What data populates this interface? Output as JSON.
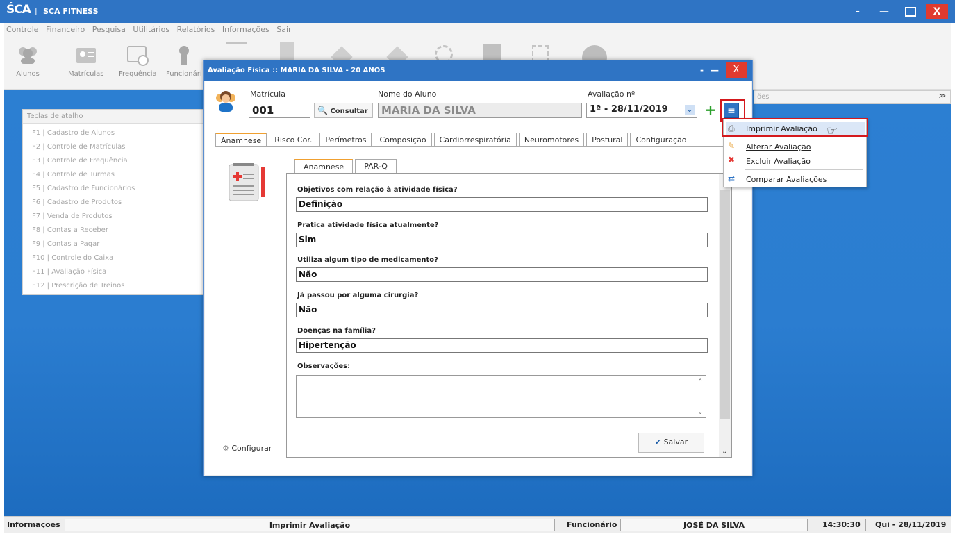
{
  "app": {
    "logo": "ŚCA",
    "title": "SCA FITNESS",
    "window_buttons": {
      "minimize": "-",
      "restore": "—",
      "close": "X"
    }
  },
  "menu": [
    "Controle",
    "Financeiro",
    "Pesquisa",
    "Utilitários",
    "Relatórios",
    "Informações",
    "Sair"
  ],
  "toolbar": {
    "items": [
      {
        "label": "Alunos",
        "icon": "students-icon"
      },
      {
        "label": "Matrículas",
        "icon": "enrollment-icon"
      },
      {
        "label": "Frequência",
        "icon": "calendar-clock-icon"
      },
      {
        "label": "Funcionári",
        "icon": "employee-icon"
      }
    ]
  },
  "shortcuts": {
    "header": "Teclas de atalho",
    "items": [
      "F1 | Cadastro de Alunos",
      "F2 | Controle de Matrículas",
      "F3 | Controle de Frequência",
      "F4 | Controle de Turmas",
      "F5 | Cadastro de Funcionários",
      "F6 | Cadastro de Produtos",
      "F7 | Venda de Produtos",
      "F8 | Contas a Receber",
      "F9 | Contas a Pagar",
      "F10 | Controle do Caixa",
      "F11 | Avaliação Física",
      "F12 | Prescrição de Treinos"
    ]
  },
  "side_strip": {
    "label": "ões",
    "toggle": "≫"
  },
  "dialog": {
    "title": "Avaliação Física  ::  MARIA DA SILVA  -  20 ANOS",
    "buttons": {
      "minimize": "-",
      "restore": "—",
      "close": "X"
    },
    "matricula_label": "Matrícula",
    "matricula_value": "001",
    "consultar_label": "Consultar",
    "nome_label": "Nome do Aluno",
    "nome_value": "MARIA DA SILVA",
    "avaliacao_label": "Avaliação nº",
    "avaliacao_value": "1ª - 28/11/2019",
    "plus_label": "+",
    "menu_label": "≡",
    "tabs": [
      "Anamnese",
      "Risco Cor.",
      "Perímetros",
      "Composição",
      "Cardiorrespiratória",
      "Neuromotores",
      "Postural",
      "Configuração"
    ],
    "subtabs": [
      "Anamnese",
      "PAR-Q"
    ],
    "questions": [
      {
        "label": "Objetivos com relação à atividade física?",
        "value": "Definição"
      },
      {
        "label": "Pratica atividade física atualmente?",
        "value": "Sim"
      },
      {
        "label": "Utiliza algum tipo de medicamento?",
        "value": "Não"
      },
      {
        "label": "Já passou por alguma cirurgia?",
        "value": "Não"
      },
      {
        "label": "Doenças na família?",
        "value": "Hipertenção"
      }
    ],
    "obs_label": "Observações:",
    "salvar_label": "Salvar",
    "configurar_label": "Configurar"
  },
  "dropdown": {
    "items": [
      {
        "label": "Imprimir Avaliação",
        "icon": "printer-icon"
      },
      {
        "label": "Alterar Avaliação",
        "icon": "pencil-icon"
      },
      {
        "label": "Excluir Avaliação",
        "icon": "delete-icon"
      },
      {
        "label": "Comparar Avaliações",
        "icon": "compare-icon"
      }
    ]
  },
  "status": {
    "info_label": "Informações",
    "info_value": "Imprimir Avaliação",
    "func_label": "Funcionário",
    "func_value": "JOSÉ DA SILVA",
    "time": "14:30:30",
    "date": "Qui - 28/11/2019"
  },
  "colors": {
    "titlebar": "#2f74c4",
    "desktop": "#2b7dd0",
    "close": "#e03a2f",
    "highlight": "#d4191d",
    "tab_accent": "#f0a030"
  }
}
